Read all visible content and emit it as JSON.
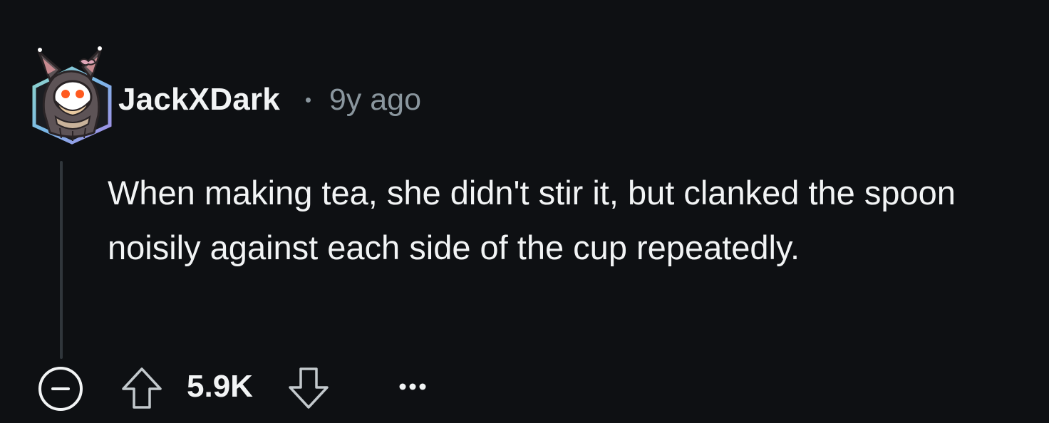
{
  "comment": {
    "author": "JackXDark",
    "separator": "•",
    "timestamp": "9y ago",
    "avatar_icon": "snoo-bat-costume-avatar",
    "body": "When making tea, she didn't stir it, but clanked the spoon noisily against each side of the cup repeatedly.",
    "score": "5.9K"
  },
  "actions": {
    "collapse_icon": "minus-circle-icon",
    "upvote_icon": "arrow-up-icon",
    "downvote_icon": "arrow-down-icon",
    "more_icon": "ellipsis-icon"
  },
  "colors": {
    "background": "#0e1013",
    "text": "#f2f4f5",
    "meta_text": "#8a969e",
    "thread_line": "#30363b",
    "avatar_frame": "#7fd1e6"
  }
}
